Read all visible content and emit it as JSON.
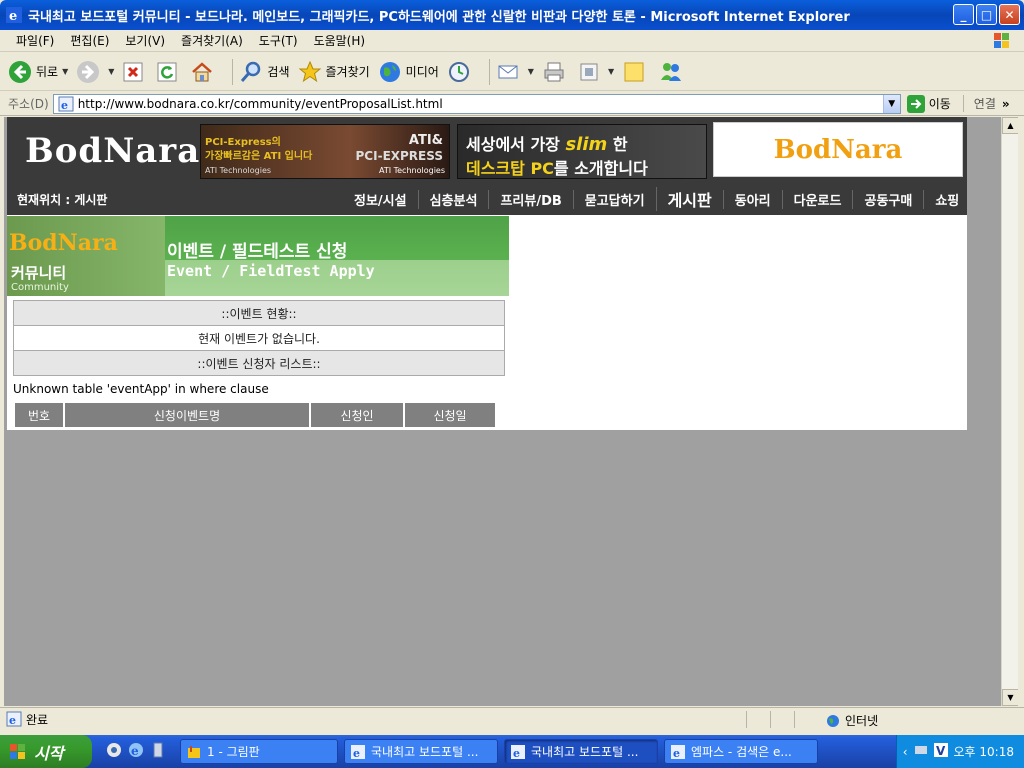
{
  "window": {
    "title": "국내최고 보드포털 커뮤니티 - 보드나라. 메인보드, 그래픽카드, PC하드웨어에 관한 신랄한 비판과 다양한 토론 - Microsoft Internet Explorer"
  },
  "menu": [
    "파일(F)",
    "편집(E)",
    "보기(V)",
    "즐겨찾기(A)",
    "도구(T)",
    "도움말(H)"
  ],
  "toolbar": {
    "back": "뒤로",
    "search": "검색",
    "favorites": "즐겨찾기",
    "media": "미디어"
  },
  "address": {
    "label": "주소(D)",
    "url": "http://www.bodnara.co.kr/community/eventProposalList.html",
    "go": "이동",
    "links": "연결"
  },
  "site": {
    "logo": "BodNara",
    "location": "현재위치 : 게시판",
    "nav": [
      "정보/시설",
      "심층분석",
      "프리뷰/DB",
      "묻고답하기",
      "게시판",
      "동아리",
      "다운로드",
      "공동구매",
      "쇼핑"
    ],
    "banner_ati": {
      "line1": "PCI-Express의",
      "line2": "가장빠르감은 ATI 입니다",
      "line3": "ATI&",
      "line4": "PCI-EXPRESS",
      "line5": "ATI Technologies",
      "line6": "ATI Technologies"
    },
    "banner_slim": {
      "line1_pre": "세상에서 가장",
      "line1_slim": "slim",
      "line1_post": "한",
      "line2_hl": "데스크탑 PC",
      "line2_post": "를 소개합니다"
    },
    "banner_logo": "BodNara"
  },
  "event_banner": {
    "logo": "BodNara",
    "community_ko": "커뮤니티",
    "community_en": "Community",
    "title_ko": "이벤트 / 필드테스트 신청",
    "title_en": "Event / FieldTest Apply"
  },
  "event_status": {
    "header": "::이벤트 현황::",
    "message": "현재 이벤트가 없습니다.",
    "applicants_header": "::이벤트 신청자 리스트::"
  },
  "error_message": "Unknown table 'eventApp' in where clause",
  "applicants_table": {
    "columns": [
      "번호",
      "신청이벤트명",
      "신청인",
      "신청일"
    ]
  },
  "statusbar": {
    "status": "완료",
    "zone": "인터넷"
  },
  "taskbar": {
    "start": "시작",
    "tasks": [
      "1 - 그림판",
      "국내최고 보드포털 ...",
      "국내최고 보드포털 ...",
      "엠파스 - 검색은 e..."
    ],
    "active_index": 2,
    "clock": "오후 10:18"
  }
}
